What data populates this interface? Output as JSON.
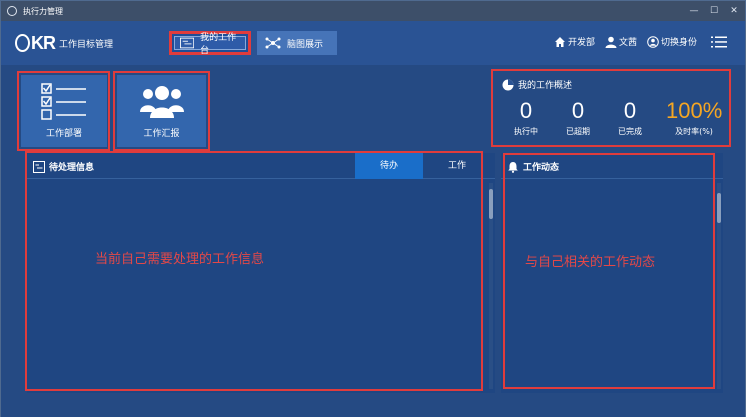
{
  "window": {
    "title": "执行力管理"
  },
  "window_controls": {
    "minimize": "—",
    "maximize": "☐",
    "close": "✕"
  },
  "header": {
    "logo_text": "工作目标管理",
    "tabs": [
      {
        "label": "我的工作台",
        "active": true
      },
      {
        "label": "脑图展示",
        "active": false
      }
    ],
    "links": [
      {
        "icon": "home-icon",
        "label": "开发部"
      },
      {
        "icon": "user-icon",
        "label": "文茜"
      },
      {
        "icon": "switch-user-icon",
        "label": "切换身份"
      }
    ],
    "menu_icon": "menu-icon"
  },
  "tiles": [
    {
      "icon": "checklist-icon",
      "label": "工作部署"
    },
    {
      "icon": "team-icon",
      "label": "工作汇报"
    }
  ],
  "overview": {
    "title": "我的工作概述",
    "stats": [
      {
        "value": "0",
        "label": "执行中"
      },
      {
        "value": "0",
        "label": "已超期"
      },
      {
        "value": "0",
        "label": "已完成"
      },
      {
        "value": "100%",
        "label": "及时率(%)"
      }
    ],
    "accent_color": "#f5a623"
  },
  "pending_panel": {
    "title": "待处理信息",
    "segments": [
      {
        "label": "待办",
        "active": true
      },
      {
        "label": "工作",
        "active": false
      }
    ],
    "annotation": "当前自己需要处理的工作信息"
  },
  "activity_panel": {
    "title": "工作动态",
    "annotation": "与自己相关的工作动态"
  }
}
